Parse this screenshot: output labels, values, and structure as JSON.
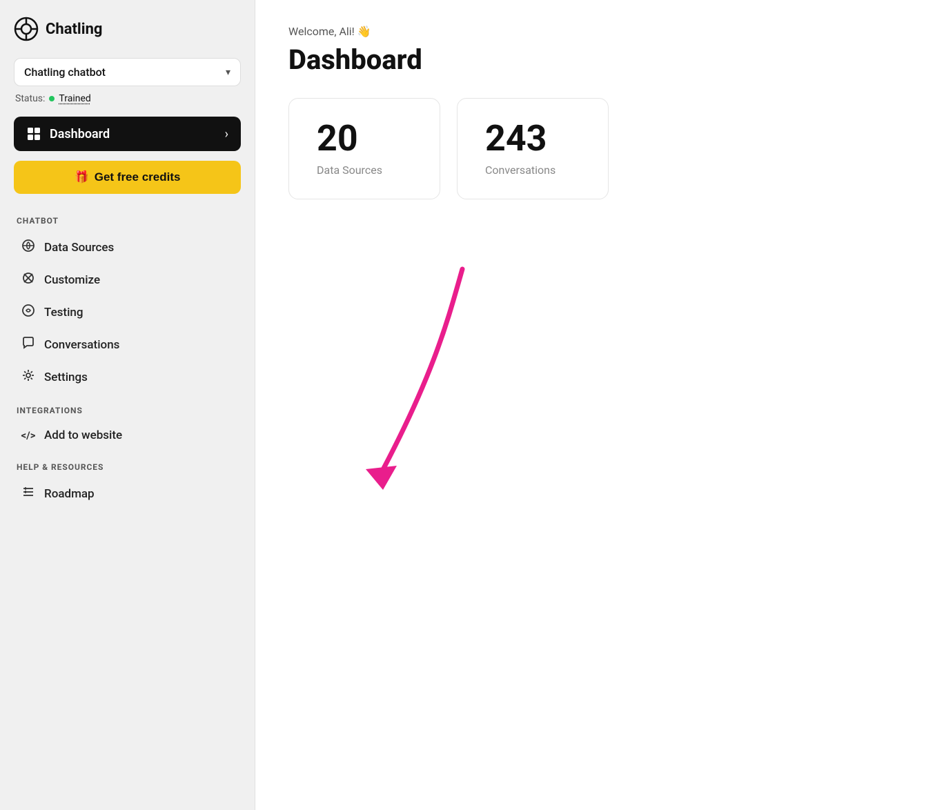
{
  "app": {
    "name": "Chatling"
  },
  "sidebar": {
    "chatbot_selector": {
      "name": "Chatling chatbot",
      "chevron": "▾"
    },
    "status": {
      "label": "Status:",
      "trained_label": "Trained"
    },
    "dashboard_nav": {
      "label": "Dashboard",
      "arrow": "›"
    },
    "get_credits_btn": {
      "icon": "🎁",
      "label": "Get free credits"
    },
    "sections": [
      {
        "section_label": "CHATBOT",
        "items": [
          {
            "icon": "🔌",
            "label": "Data Sources"
          },
          {
            "icon": "✂",
            "label": "Customize"
          },
          {
            "icon": "💬",
            "label": "Testing"
          },
          {
            "icon": "💬",
            "label": "Conversations"
          },
          {
            "icon": "⚙",
            "label": "Settings"
          }
        ]
      },
      {
        "section_label": "INTEGRATIONS",
        "items": [
          {
            "icon": "</>",
            "label": "Add to website"
          }
        ]
      },
      {
        "section_label": "HELP & RESOURCES",
        "items": [
          {
            "icon": "≡",
            "label": "Roadmap"
          }
        ]
      }
    ]
  },
  "main": {
    "welcome": "Welcome, Ali! 👋",
    "title": "Dashboard",
    "stats": [
      {
        "number": "20",
        "label": "Data Sources"
      },
      {
        "number": "243",
        "label": "Conversations"
      }
    ]
  }
}
